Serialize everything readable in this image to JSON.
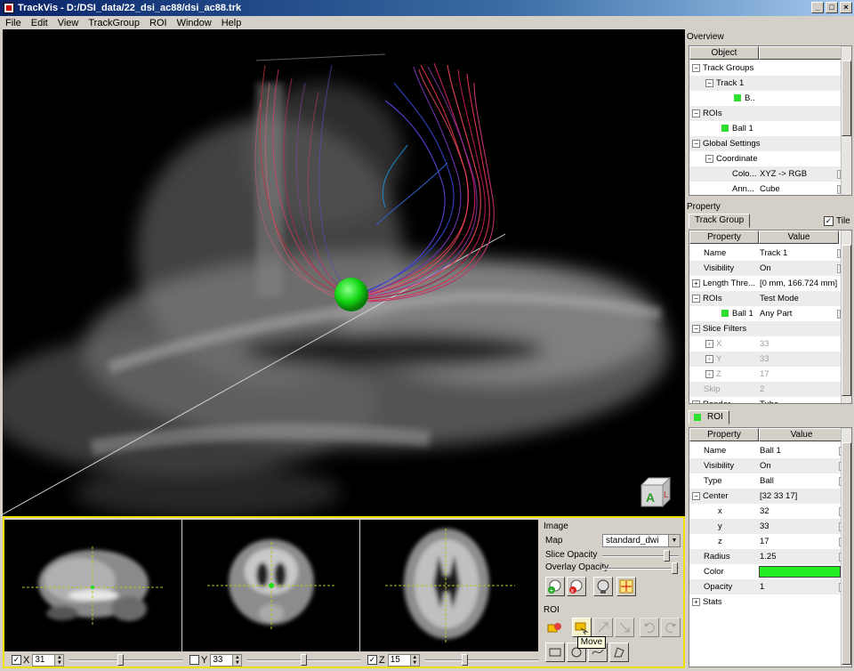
{
  "window": {
    "title": "TrackVis - D:/DSI_data/22_dsi_ac88/dsi_ac88.trk"
  },
  "menu": [
    "File",
    "Edit",
    "View",
    "TrackGroup",
    "ROI",
    "Window",
    "Help"
  ],
  "orientation_cube": {
    "labels": [
      "A",
      "L"
    ]
  },
  "slices": [
    {
      "axis": "X",
      "checked": true,
      "value": "31",
      "slider": 0.45
    },
    {
      "axis": "Y",
      "checked": false,
      "value": "33",
      "slider": 0.5
    },
    {
      "axis": "Z",
      "checked": true,
      "value": "15",
      "slider": 0.35
    }
  ],
  "image_panel": {
    "title": "Image",
    "map_label": "Map",
    "map_value": "standard_dwi",
    "slice_opacity_label": "Slice Opacity",
    "slice_opacity": 0.85,
    "overlay_opacity_label": "Overlay Opacity",
    "overlay_opacity": 0.95,
    "roi_label": "ROI",
    "tooltip": "Move"
  },
  "overview": {
    "title": "Overview",
    "column": "Object",
    "items": [
      {
        "label": "Track Groups"
      },
      {
        "label": "Track 1"
      },
      {
        "label": "B.."
      },
      {
        "label": "ROIs"
      },
      {
        "label": "Ball 1"
      },
      {
        "label": "Global Settings"
      },
      {
        "label": "Coordinate"
      },
      {
        "key": "Colo...",
        "value": "XYZ -> RGB"
      },
      {
        "key": "Ann...",
        "value": "Cube"
      }
    ]
  },
  "property": {
    "title": "Property",
    "tab": "Track Group",
    "tile_label": "Tile",
    "tile_checked": true,
    "col_property": "Property",
    "col_value": "Value",
    "rows": [
      {
        "key": "Name",
        "value": "Track 1"
      },
      {
        "key": "Visibility",
        "value": "On"
      },
      {
        "key": "Length Thre...",
        "value": "[0 mm,  166.724 mm]"
      },
      {
        "key": "ROIs",
        "value": "Test Mode"
      },
      {
        "key": "Ball 1",
        "value": "Any Part"
      },
      {
        "key": "Slice Filters",
        "value": ""
      },
      {
        "key": "X",
        "value": "33"
      },
      {
        "key": "Y",
        "value": "33"
      },
      {
        "key": "Z",
        "value": "17"
      },
      {
        "key": "Skip",
        "value": "2"
      },
      {
        "key": "Render",
        "value": "Tube"
      }
    ]
  },
  "roi": {
    "tab": "ROI",
    "col_property": "Property",
    "col_value": "Value",
    "rows": [
      {
        "key": "Name",
        "value": "Ball 1"
      },
      {
        "key": "Visibility",
        "value": "On"
      },
      {
        "key": "Type",
        "value": "Ball"
      },
      {
        "key": "Center",
        "value": "[32 33 17]"
      },
      {
        "key": "x",
        "value": "32"
      },
      {
        "key": "y",
        "value": "33"
      },
      {
        "key": "z",
        "value": "17"
      },
      {
        "key": "Radius",
        "value": "1.25"
      },
      {
        "key": "Color",
        "value": ""
      },
      {
        "key": "Opacity",
        "value": "1"
      },
      {
        "key": "Stats",
        "value": ""
      }
    ],
    "color": "#22ee22"
  }
}
